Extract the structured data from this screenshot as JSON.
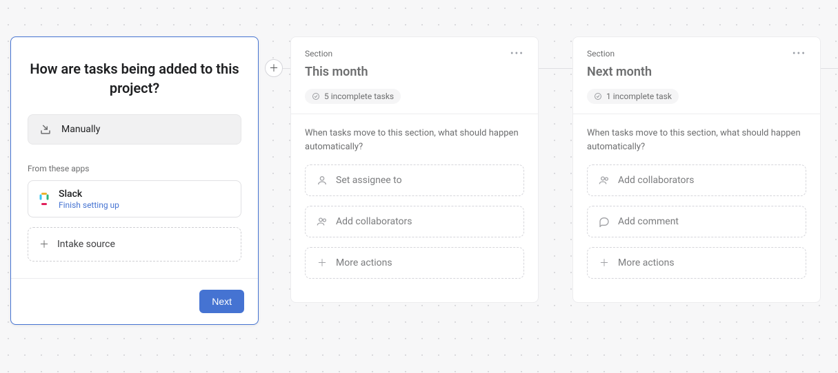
{
  "wizard": {
    "title": "How are tasks being added to this project?",
    "manual_option_label": "Manually",
    "from_apps_label": "From these apps",
    "apps": {
      "slack_name": "Slack",
      "slack_sub": "Finish setting up"
    },
    "intake_label": "Intake source",
    "next_button_label": "Next"
  },
  "sections": {
    "label": "Section",
    "automation_prompt": "When tasks move to this section, what should happen automatically?",
    "action_set_assignee": "Set assignee to",
    "action_add_collaborators": "Add collaborators",
    "action_add_comment": "Add comment",
    "action_more": "More actions",
    "a": {
      "title": "This month",
      "incomplete": "5 incomplete tasks"
    },
    "b": {
      "title": "Next month",
      "incomplete": "1 incomplete task"
    }
  }
}
